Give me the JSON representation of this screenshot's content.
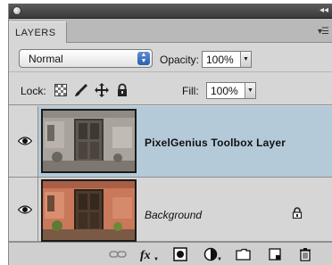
{
  "panel": {
    "tab_label": "LAYERS"
  },
  "options": {
    "blend_mode": "Normal",
    "opacity_label": "Opacity:",
    "opacity_value": "100%",
    "lock_label": "Lock:",
    "fill_label": "Fill:",
    "fill_value": "100%"
  },
  "layers": [
    {
      "name": "PixelGenius Toolbox Layer",
      "selected": true,
      "visible": true
    },
    {
      "name": "Background",
      "selected": false,
      "visible": true,
      "locked": true
    }
  ],
  "icons": {
    "titlebar": [
      "close-icon",
      "collapse-icon"
    ],
    "locks": [
      "lock-transparent-icon",
      "lock-image-icon",
      "lock-position-icon",
      "lock-all-icon"
    ],
    "bottom": [
      "link-layers-icon",
      "layer-style-fx-icon",
      "add-mask-icon",
      "adjustment-layer-icon",
      "new-group-icon",
      "new-layer-icon",
      "delete-layer-icon"
    ]
  },
  "colors": {
    "selected_row": "#b4cad9",
    "panel_bg": "#d6d6d6"
  }
}
